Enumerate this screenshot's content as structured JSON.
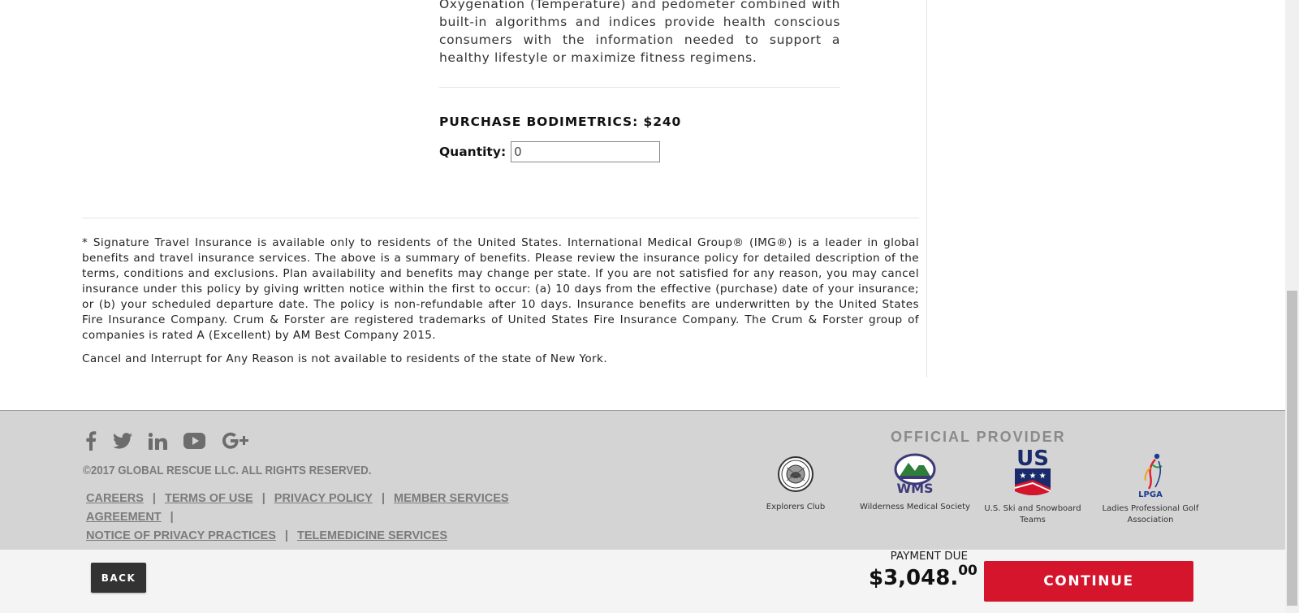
{
  "product": {
    "description": "Oxygenation (Temperature) and pedometer combined with built-in algorithms and indices provide health conscious consumers with the information needed to support a healthy lifestyle or maximize fitness regimens.",
    "purchase_title": "PURCHASE BODIMETRICS: $240",
    "quantity_label": "Quantity:",
    "quantity_value": "0"
  },
  "disclaimer": {
    "main": "* Signature Travel Insurance is available only to residents of the United States. International Medical Group® (IMG®) is a leader in global benefits and travel insurance services. The above is a summary of benefits. Please review the insurance policy for detailed description of the terms, conditions and exclusions. Plan availability and benefits may change per state. If you are not satisfied for any reason, you may cancel insurance under this policy by giving written notice within the first to occur: (a) 10 days from the effective (purchase) date of your insurance; or (b) your scheduled departure date. The policy is non-refundable after 10 days. Insurance benefits are underwritten by the United States Fire Insurance Company. Crum & Forster are registered trademarks of United States Fire Insurance Company. The Crum & Forster group of companies is rated A (Excellent) by AM Best Company 2015.",
    "ny_note": "Cancel and Interrupt for Any Reason is not available to residents of the state of New York."
  },
  "footer": {
    "social_icons": [
      "facebook-icon",
      "twitter-icon",
      "linkedin-icon",
      "youtube-icon",
      "google-plus-icon"
    ],
    "copyright": "©2017 GLOBAL RESCUE LLC. ALL RIGHTS RESERVED.",
    "links": {
      "careers": "CAREERS",
      "terms": "TERMS OF USE",
      "privacy": "PRIVACY POLICY",
      "member_services": "MEMBER SERVICES AGREEMENT",
      "notice_privacy": "NOTICE OF PRIVACY PRACTICES",
      "telemedicine": "TELEMEDICINE SERVICES",
      "separator": "|"
    },
    "provider_title": "OFFICIAL PROVIDER",
    "providers": {
      "explorers": "Explorers Club",
      "wms": "Wilderness Medical Society",
      "ussa_line1": "U.S. Ski and Snowboard",
      "ussa_line2": "Teams",
      "lpga_line1": "Ladies Professional Golf",
      "lpga_line2": "Association"
    },
    "logo_text": {
      "wms": "WMS",
      "us": "US",
      "lpga": "LPGA"
    }
  },
  "bottom_bar": {
    "back_label": "BACK",
    "payment_due_label": "PAYMENT DUE",
    "amount_main": "$3,048.",
    "amount_cents": "00",
    "continue_label": "CONTINUE"
  },
  "colors": {
    "accent": "#d4152c",
    "footer_bg": "#d4d4d4",
    "dark_button": "#333333"
  }
}
